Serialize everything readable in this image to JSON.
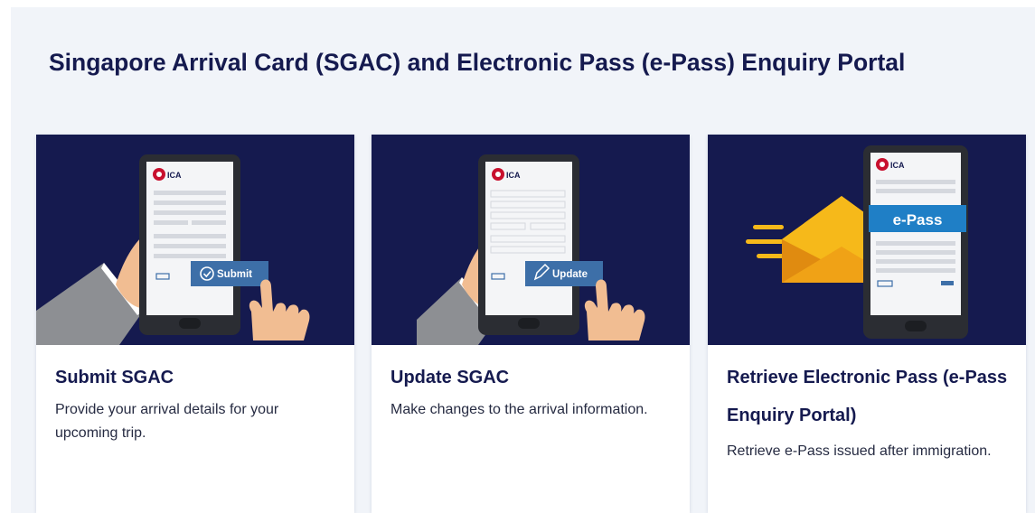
{
  "page": {
    "title": "Singapore Arrival Card (SGAC) and Electronic Pass (e-Pass) Enquiry Portal"
  },
  "colors": {
    "navy": "#151a4f",
    "button_blue": "#3d6fa8",
    "epass_blue": "#1f7fc6",
    "envelope_yellow": "#f6b91a",
    "skin": "#f1bd92"
  },
  "cards": [
    {
      "title": "Submit SGAC",
      "description": "Provide your arrival details for your upcoming trip.",
      "button_label": "Submit",
      "logo_text": "ICA",
      "icon": "check-circle-icon"
    },
    {
      "title": "Update SGAC",
      "description": "Make changes to the arrival information.",
      "button_label": "Update",
      "logo_text": "ICA",
      "icon": "pencil-icon"
    },
    {
      "title": "Retrieve Electronic Pass (e-Pass Enquiry Portal)",
      "description": "Retrieve e-Pass issued after immigration.",
      "banner_label": "e-Pass",
      "logo_text": "ICA",
      "icon": "envelope-icon"
    }
  ]
}
